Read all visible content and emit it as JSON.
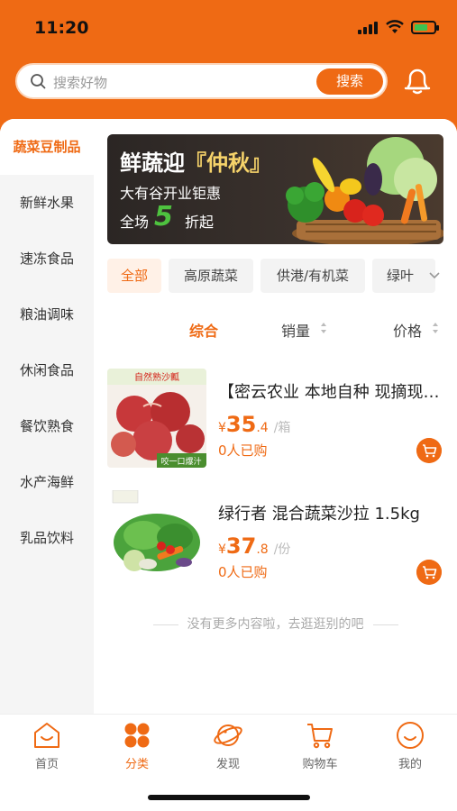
{
  "status_bar": {
    "time": "11:20"
  },
  "search": {
    "placeholder": "搜索好物",
    "button_label": "搜索"
  },
  "sidebar": {
    "items": [
      {
        "label": "蔬菜豆制品",
        "active": true
      },
      {
        "label": "新鲜水果"
      },
      {
        "label": "速冻食品"
      },
      {
        "label": "粮油调味"
      },
      {
        "label": "休闲食品"
      },
      {
        "label": "餐饮熟食"
      },
      {
        "label": "水产海鲜"
      },
      {
        "label": "乳品饮料"
      }
    ]
  },
  "banner": {
    "title_prefix": "鲜蔬迎",
    "title_highlight": "『仲秋』",
    "subtitle": "大有谷开业钜惠",
    "line3_prefix": "全场",
    "discount": "5",
    "line3_suffix": "折起"
  },
  "tags": [
    {
      "label": "全部",
      "active": true
    },
    {
      "label": "高原蔬菜"
    },
    {
      "label": "供港/有机菜"
    },
    {
      "label": "绿叶"
    }
  ],
  "sort": {
    "overall": "综合",
    "sales": "销量",
    "price": "价格"
  },
  "products": [
    {
      "name": "【密云农业 本地自种 现摘现发】自然熟沙瓤西红柿",
      "currency": "¥",
      "price_int": "35",
      "price_dec": ".4",
      "unit": "/箱",
      "sold": "0人已购",
      "img_text_top": "自然熟沙瓤",
      "img_text_bottom": "咬一口爆汁"
    },
    {
      "name": "绿行者 混合蔬菜沙拉 1.5kg",
      "currency": "¥",
      "price_int": "37",
      "price_dec": ".8",
      "unit": "/份",
      "sold": "0人已购"
    }
  ],
  "no_more_text": "没有更多内容啦，去逛逛别的吧",
  "tabbar": [
    {
      "label": "首页",
      "icon": "home-icon"
    },
    {
      "label": "分类",
      "icon": "category-icon",
      "active": true
    },
    {
      "label": "发现",
      "icon": "discover-icon"
    },
    {
      "label": "购物车",
      "icon": "cart-icon"
    },
    {
      "label": "我的",
      "icon": "profile-icon"
    }
  ],
  "colors": {
    "accent": "#ef6a14",
    "sidebar_bg": "#f5f5f5"
  }
}
